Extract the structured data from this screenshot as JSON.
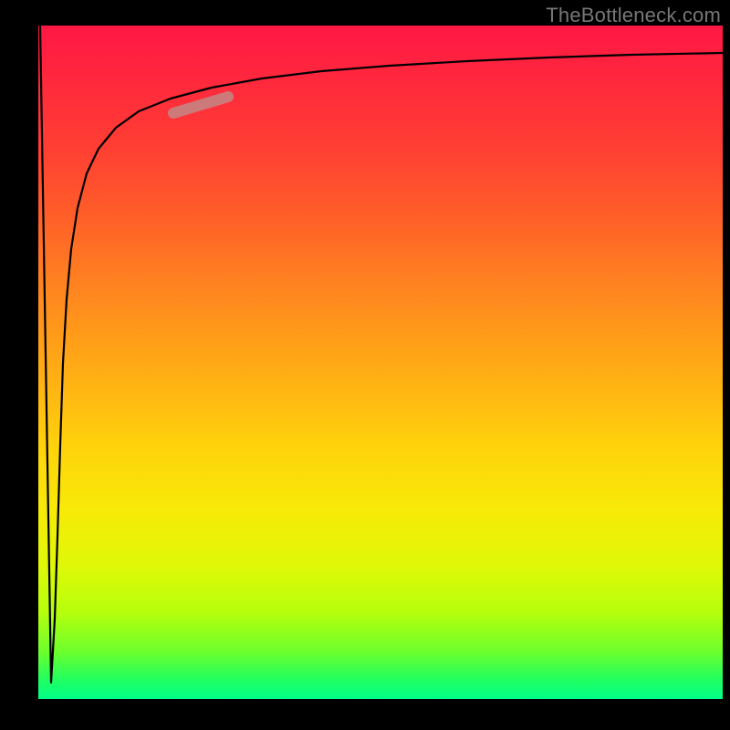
{
  "watermark": "TheBottleneck.com",
  "chart_data": {
    "type": "line",
    "title": "",
    "xlabel": "",
    "ylabel": "",
    "xlim": [
      0,
      100
    ],
    "ylim": [
      0,
      100
    ],
    "grid": false,
    "legend": false,
    "background_gradient": {
      "direction": "vertical",
      "stops": [
        {
          "pos": 0,
          "color": "#ff1744"
        },
        {
          "pos": 50,
          "color": "#ffb512"
        },
        {
          "pos": 78,
          "color": "#ffe607"
        },
        {
          "pos": 100,
          "color": "#00ff88"
        }
      ]
    },
    "series": [
      {
        "name": "bottleneck-curve",
        "x": [
          0,
          0.5,
          1,
          1.5,
          2,
          2.5,
          3,
          3.5,
          4,
          5,
          6,
          8,
          10,
          15,
          20,
          25,
          30,
          40,
          50,
          60,
          70,
          80,
          90,
          100
        ],
        "y": [
          100,
          50,
          5,
          20,
          40,
          55,
          65,
          72,
          77,
          82,
          85,
          88,
          89.5,
          91,
          92,
          92.7,
          93.3,
          94,
          94.5,
          94.9,
          95.2,
          95.5,
          95.7,
          95.9
        ]
      }
    ],
    "annotations": [
      {
        "name": "highlight-marker",
        "approx_x_range": [
          20,
          28
        ],
        "approx_y_range": [
          87,
          89
        ],
        "style": "thick-rounded-stroke",
        "color": "#c88080"
      }
    ]
  }
}
